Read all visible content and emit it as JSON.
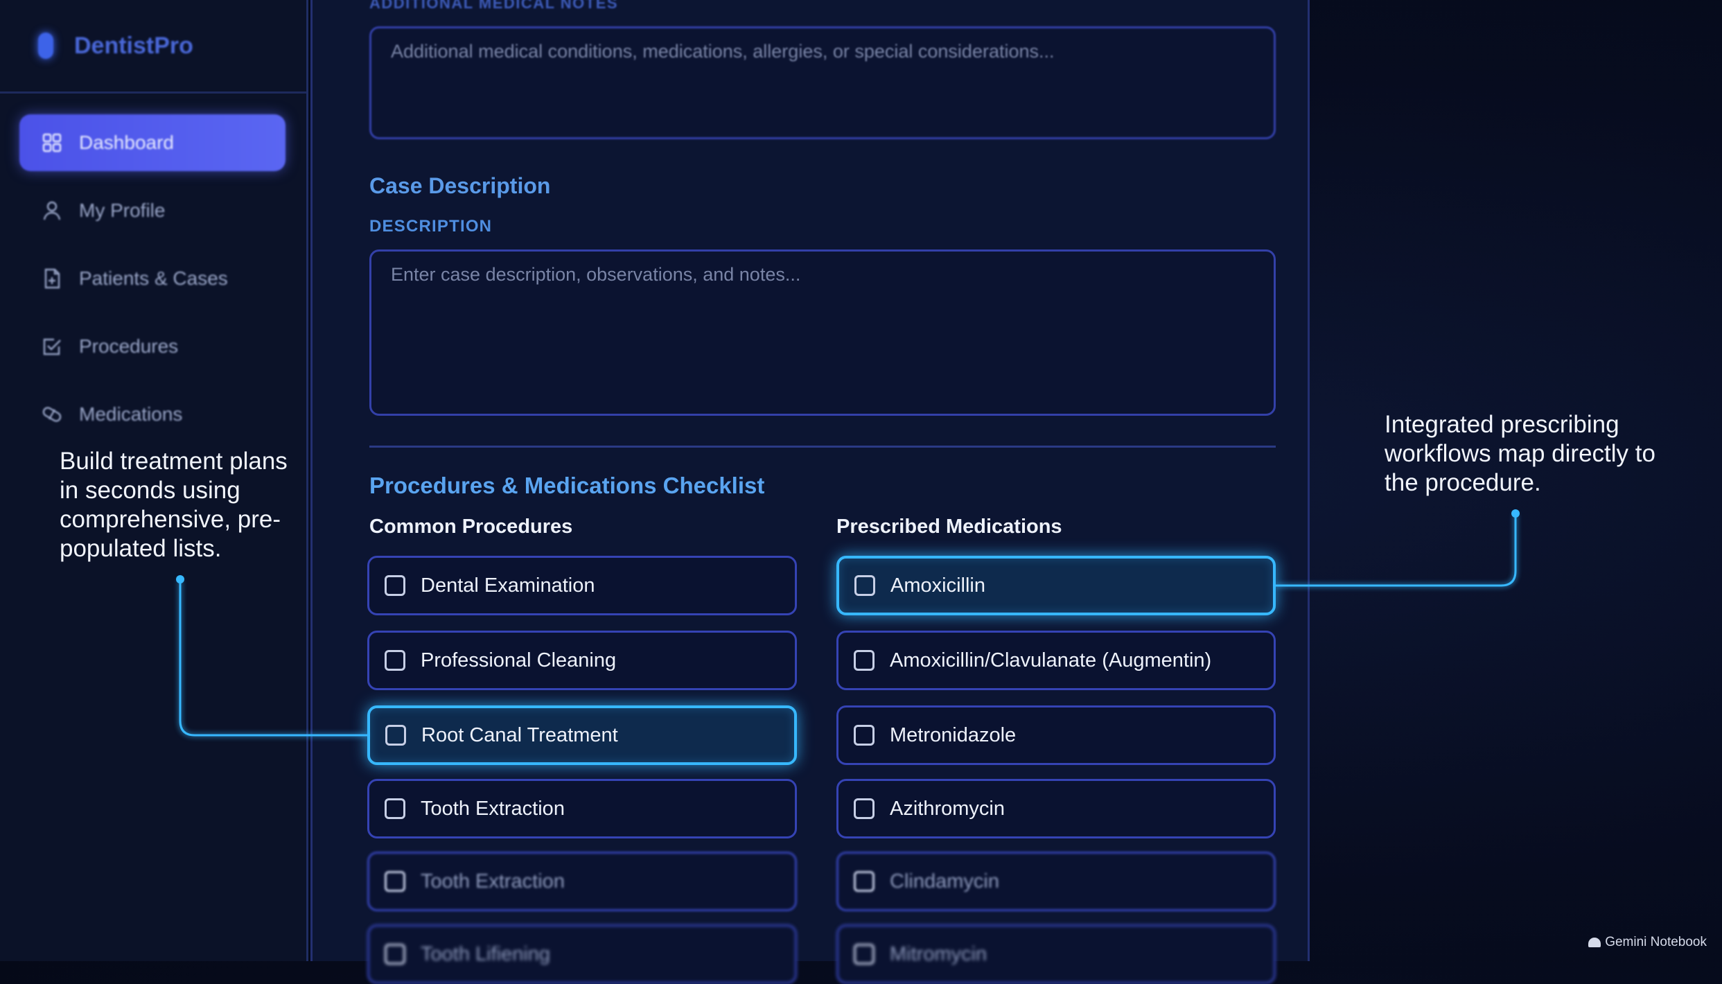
{
  "sidebar": {
    "brand": "DentistPro",
    "items": [
      {
        "label": "Dashboard",
        "icon": "grid-icon",
        "active": true
      },
      {
        "label": "My Profile",
        "icon": "user-icon",
        "active": false
      },
      {
        "label": "Patients & Cases",
        "icon": "document-icon",
        "active": false
      },
      {
        "label": "Procedures",
        "icon": "checklist-icon",
        "active": false
      },
      {
        "label": "Medications",
        "icon": "pill-icon",
        "active": false
      }
    ]
  },
  "form": {
    "medical_notes_label": "ADDITIONAL MEDICAL NOTES",
    "medical_notes_placeholder": "Additional medical conditions, medications, allergies, or special considerations...",
    "case_heading": "Case Description",
    "description_label": "DESCRIPTION",
    "description_placeholder": "Enter case description, observations, and notes...",
    "checklist_heading": "Procedures & Medications Checklist",
    "procedures_heading": "Common Procedures",
    "medications_heading": "Prescribed Medications",
    "procedures": [
      {
        "label": "Dental Examination",
        "highlighted": false
      },
      {
        "label": "Professional Cleaning",
        "highlighted": false
      },
      {
        "label": "Root Canal Treatment",
        "highlighted": true
      },
      {
        "label": "Tooth Extraction",
        "highlighted": false
      },
      {
        "label": "Tooth Extraction",
        "highlighted": false
      },
      {
        "label": "Tooth Lifiening",
        "highlighted": false
      }
    ],
    "medications": [
      {
        "label": "Amoxicillin",
        "highlighted": true
      },
      {
        "label": "Amoxicillin/Clavulanate (Augmentin)",
        "highlighted": false
      },
      {
        "label": "Metronidazole",
        "highlighted": false
      },
      {
        "label": "Azithromycin",
        "highlighted": false
      },
      {
        "label": "Clindamycin",
        "highlighted": false
      },
      {
        "label": "Mitromycin",
        "highlighted": false
      }
    ]
  },
  "annotations": {
    "left": "Build treatment plans in seconds using comprehensive, pre-populated lists.",
    "right": "Integrated prescribing workflows map directly to the procedure."
  },
  "watermark": "Gemini Notebook",
  "colors": {
    "accent_glow": "#37b8ff",
    "active_nav": "#5058ec",
    "panel_border": "#3543b4"
  }
}
